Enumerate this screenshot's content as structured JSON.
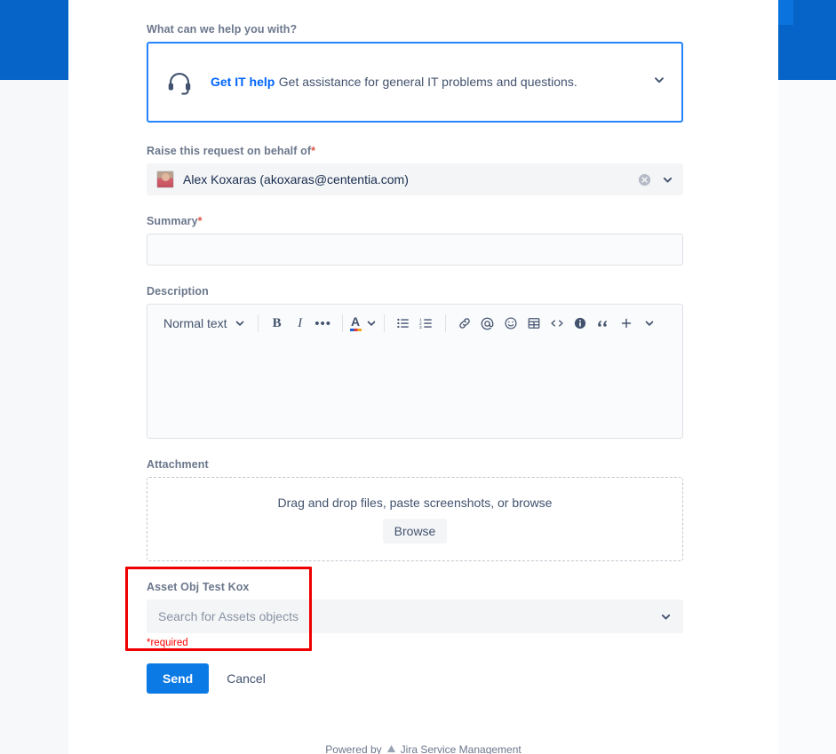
{
  "request_type": {
    "section_label": "What can we help you with?",
    "icon": "headset-icon",
    "title": "Get IT help",
    "description": "Get assistance for general IT problems and questions.",
    "chevron": "chevron-down-icon"
  },
  "on_behalf_of": {
    "label": "Raise this request on behalf of",
    "required_marker": "*",
    "value": "Alex Koxaras (akoxaras@cententia.com)",
    "clear_icon": "clear-circle-icon",
    "chevron": "chevron-down-icon"
  },
  "summary": {
    "label": "Summary",
    "required_marker": "*",
    "value": "",
    "placeholder": ""
  },
  "description": {
    "label": "Description",
    "value": "",
    "toolbar": {
      "text_style": "Normal text",
      "bold": "B",
      "italic": "I",
      "more": "•••",
      "text_color": "A",
      "bullet_list": "bullet-list-icon",
      "numbered_list": "numbered-list-icon",
      "link": "link-icon",
      "mention": "mention-icon",
      "emoji": "emoji-icon",
      "table": "table-icon",
      "code": "code-icon",
      "info_panel": "info-panel-icon",
      "quote": "quote-icon",
      "insert_more": "plus-icon",
      "insert_chevron": "chevron-down-icon"
    }
  },
  "attachment": {
    "label": "Attachment",
    "dropzone_text": "Drag and drop files, paste screenshots, or browse",
    "browse_label": "Browse"
  },
  "asset_field": {
    "label": "Asset Obj Test Kox",
    "placeholder": "Search for Assets objects",
    "value": "",
    "error": "*required",
    "chevron": "chevron-down-icon",
    "highlight_color": "#ee0000"
  },
  "actions": {
    "send_label": "Send",
    "cancel_label": "Cancel"
  },
  "footer": {
    "text_before": "Powered by",
    "brand": "Jira Service Management"
  },
  "colors": {
    "brand_blue": "#0663c7",
    "accent_blue": "#0b73de",
    "selected_border": "#2684ff",
    "link_blue": "#0065ff",
    "primary_button": "#0b7ae5",
    "label_gray": "#6b778c",
    "text_dark": "#172b4d",
    "field_bg": "#f4f5f7",
    "error_red": "#ff0000"
  }
}
